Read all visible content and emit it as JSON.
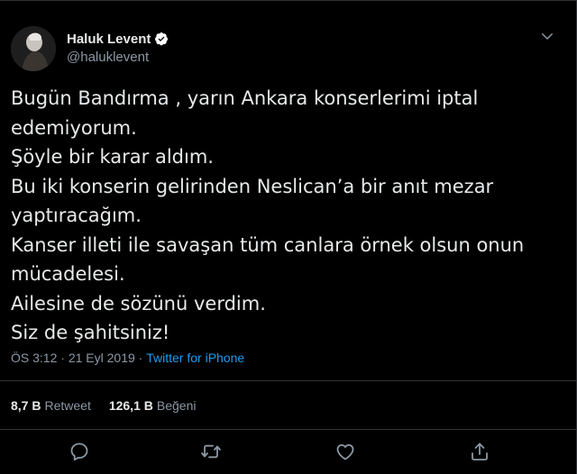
{
  "user": {
    "display_name": "Haluk Levent",
    "handle": "@haluklevent",
    "verified_icon": "verified-badge-icon"
  },
  "tweet": {
    "lines": [
      "Bugün Bandırma , yarın Ankara konserlerimi iptal",
      "edemiyorum.",
      "Şöyle bir karar aldım.",
      "Bu iki konserin gelirinden Neslican’a  bir anıt mezar",
      "yaptıracağım.",
      "Kanser illeti ile savaşan tüm canlara örnek olsun onun",
      "mücadelesi.",
      "Ailesine de sözünü verdim.",
      "Siz de şahitsiniz!"
    ],
    "time": "ÖS 3:12",
    "separator": " · ",
    "date": "21 Eyl 2019",
    "source": "Twitter for iPhone"
  },
  "stats": {
    "retweets_count": "8,7 B",
    "retweets_label": "Retweet",
    "likes_count": "126,1 B",
    "likes_label": "Beğeni"
  },
  "actions": [
    "reply-icon",
    "retweet-icon",
    "like-icon",
    "share-icon"
  ],
  "colors": {
    "background": "#000000",
    "text": "#e7e9ea",
    "secondary": "#8b98a5",
    "link": "#1d9bf0",
    "divider": "#2f3336"
  }
}
